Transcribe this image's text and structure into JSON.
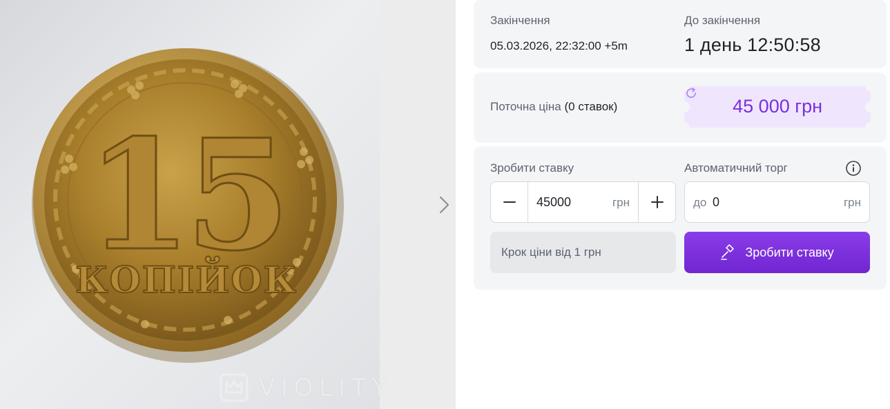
{
  "listing": {
    "image_alt": "Монета 15 копійок",
    "watermark": "VIOLITY"
  },
  "auction_end": {
    "label": "Закінчення",
    "date": "05.03.2026, 22:32:00 +5m"
  },
  "time_left": {
    "label": "До закінчення",
    "value": "1 день 12:50:58"
  },
  "current_price": {
    "label": "Поточна ціна",
    "bids_count": "(0 ставок)",
    "value": "45 000 грн",
    "accent_color": "#7b2ee0"
  },
  "place_bid": {
    "label": "Зробити ставку",
    "amount": "45000",
    "currency": "грн"
  },
  "auto_bid": {
    "label": "Автоматичний торг",
    "prefix": "до",
    "amount": "0",
    "currency": "грн"
  },
  "bid_step_note": "Крок ціни від 1 грн",
  "submit_button": {
    "label": "Зробити ставку",
    "color": "#7b2ee0"
  },
  "icons": [
    "chevron-right-icon",
    "refresh-icon",
    "minus-icon",
    "plus-icon",
    "info-icon",
    "gavel-icon",
    "crown-logo-icon"
  ]
}
